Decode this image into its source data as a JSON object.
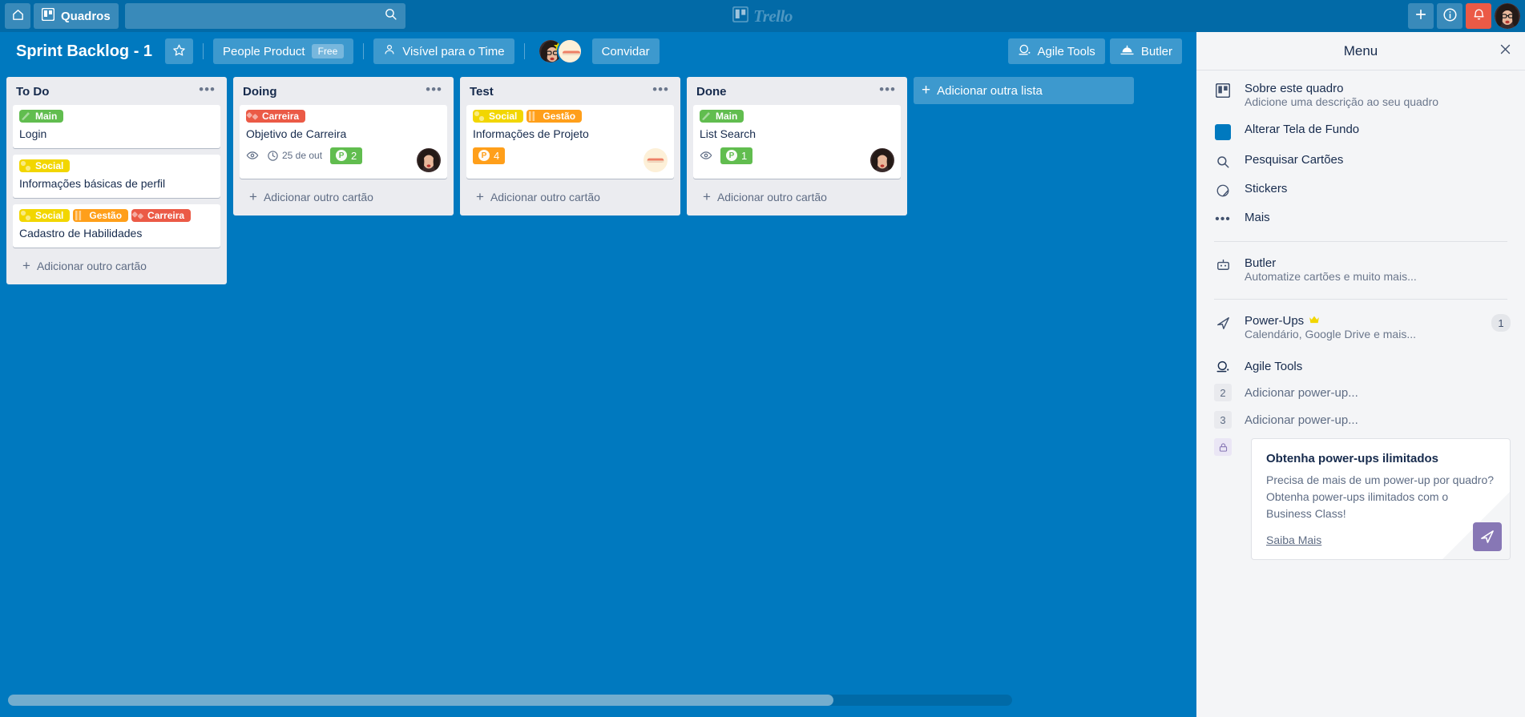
{
  "top_nav": {
    "home_icon": "home-icon",
    "boards_label": "Quadros",
    "boards_icon": "board-icon",
    "search_placeholder": "",
    "search_value": "",
    "search_icon": "search-icon",
    "logo_text": "Trello",
    "add_icon": "plus-icon",
    "info_icon": "info-icon",
    "bell_icon": "bell-icon",
    "avatar": "user-avatar"
  },
  "board_header": {
    "title": "Sprint Backlog - 1",
    "star_icon": "star-icon",
    "team_name": "People Product",
    "plan_badge": "Free",
    "visibility_label": "Visível para o Time",
    "visibility_icon": "team-visibility-icon",
    "invite_label": "Convidar",
    "agile_tools_label": "Agile Tools",
    "butler_label": "Butler"
  },
  "board": {
    "add_list_label": "Adicionar outra lista",
    "add_card_label": "Adicionar outro cartão",
    "list_menu_icon": "ellipsis-icon",
    "lists": [
      {
        "title": "To Do",
        "cards": [
          {
            "labels": [
              {
                "text": "Main",
                "color": "#61bd4f"
              }
            ],
            "title": "Login",
            "watching": false,
            "due": null,
            "points": null,
            "avatar": null
          },
          {
            "labels": [
              {
                "text": "Social",
                "color": "#f2d600"
              }
            ],
            "title": "Informações básicas de perfil",
            "watching": false,
            "due": null,
            "points": null,
            "avatar": null
          },
          {
            "labels": [
              {
                "text": "Social",
                "color": "#f2d600"
              },
              {
                "text": "Gestão",
                "color": "#ff9f1a"
              },
              {
                "text": "Carreira",
                "color": "#eb5a46"
              }
            ],
            "title": "Cadastro de Habilidades",
            "watching": false,
            "due": null,
            "points": null,
            "avatar": null
          }
        ]
      },
      {
        "title": "Doing",
        "cards": [
          {
            "labels": [
              {
                "text": "Carreira",
                "color": "#eb5a46"
              }
            ],
            "title": "Objetivo de Carreira",
            "watching": true,
            "due": "25 de out",
            "points": {
              "value": "2",
              "letter": "P",
              "color": "#61bd4f"
            },
            "avatar": "member-avatar"
          }
        ]
      },
      {
        "title": "Test",
        "cards": [
          {
            "labels": [
              {
                "text": "Social",
                "color": "#f2d600"
              },
              {
                "text": "Gestão",
                "color": "#ff9f1a"
              }
            ],
            "title": "Informações de Projeto",
            "watching": false,
            "due": null,
            "points": {
              "value": "4",
              "letter": "P",
              "color": "#ff9f1a"
            },
            "avatar": "member-avatar-2"
          }
        ]
      },
      {
        "title": "Done",
        "cards": [
          {
            "labels": [
              {
                "text": "Main",
                "color": "#61bd4f"
              }
            ],
            "title": "List Search",
            "watching": true,
            "due": null,
            "points": {
              "value": "1",
              "letter": "P",
              "color": "#61bd4f"
            },
            "avatar": "member-avatar"
          }
        ]
      }
    ]
  },
  "sidebar": {
    "title": "Menu",
    "close_icon": "close-icon",
    "items": [
      {
        "icon": "board-icon",
        "title": "Sobre este quadro",
        "sub": "Adicione uma descrição ao seu quadro"
      },
      {
        "icon": "background-swatch-icon",
        "title": "Alterar Tela de Fundo",
        "sub": ""
      },
      {
        "icon": "search-icon",
        "title": "Pesquisar Cartões",
        "sub": ""
      },
      {
        "icon": "sticker-icon",
        "title": "Stickers",
        "sub": ""
      },
      {
        "icon": "ellipsis-icon",
        "title": "Mais",
        "sub": ""
      }
    ],
    "butler": {
      "icon": "robot-icon",
      "title": "Butler",
      "sub": "Automatize cartões e muito mais..."
    },
    "powerups": {
      "icon": "rocket-icon",
      "title": "Power-Ups",
      "crown_icon": "crown-icon",
      "sub": "Calendário, Google Drive e mais...",
      "count": "1"
    },
    "powerup_rows": [
      {
        "kind": "installed",
        "icon": "agile-tools-icon",
        "label": "Agile Tools"
      },
      {
        "kind": "slot",
        "num": "2",
        "label": "Adicionar power-up..."
      },
      {
        "kind": "slot",
        "num": "3",
        "label": "Adicionar power-up..."
      }
    ],
    "promo": {
      "lock_icon": "lock-icon",
      "title": "Obtenha power-ups ilimitados",
      "body": "Precisa de mais de um power-up por quadro? Obtenha power-ups ilimitados com o Business Class!",
      "link": "Saiba Mais",
      "rocket_icon": "rocket-icon"
    }
  },
  "colors": {
    "board_bg": "#0079bf",
    "top_nav": "#026aa7",
    "list_bg": "#ebecf0",
    "sidebar_bg": "#f4f5f7",
    "bell": "#eb5a46"
  }
}
